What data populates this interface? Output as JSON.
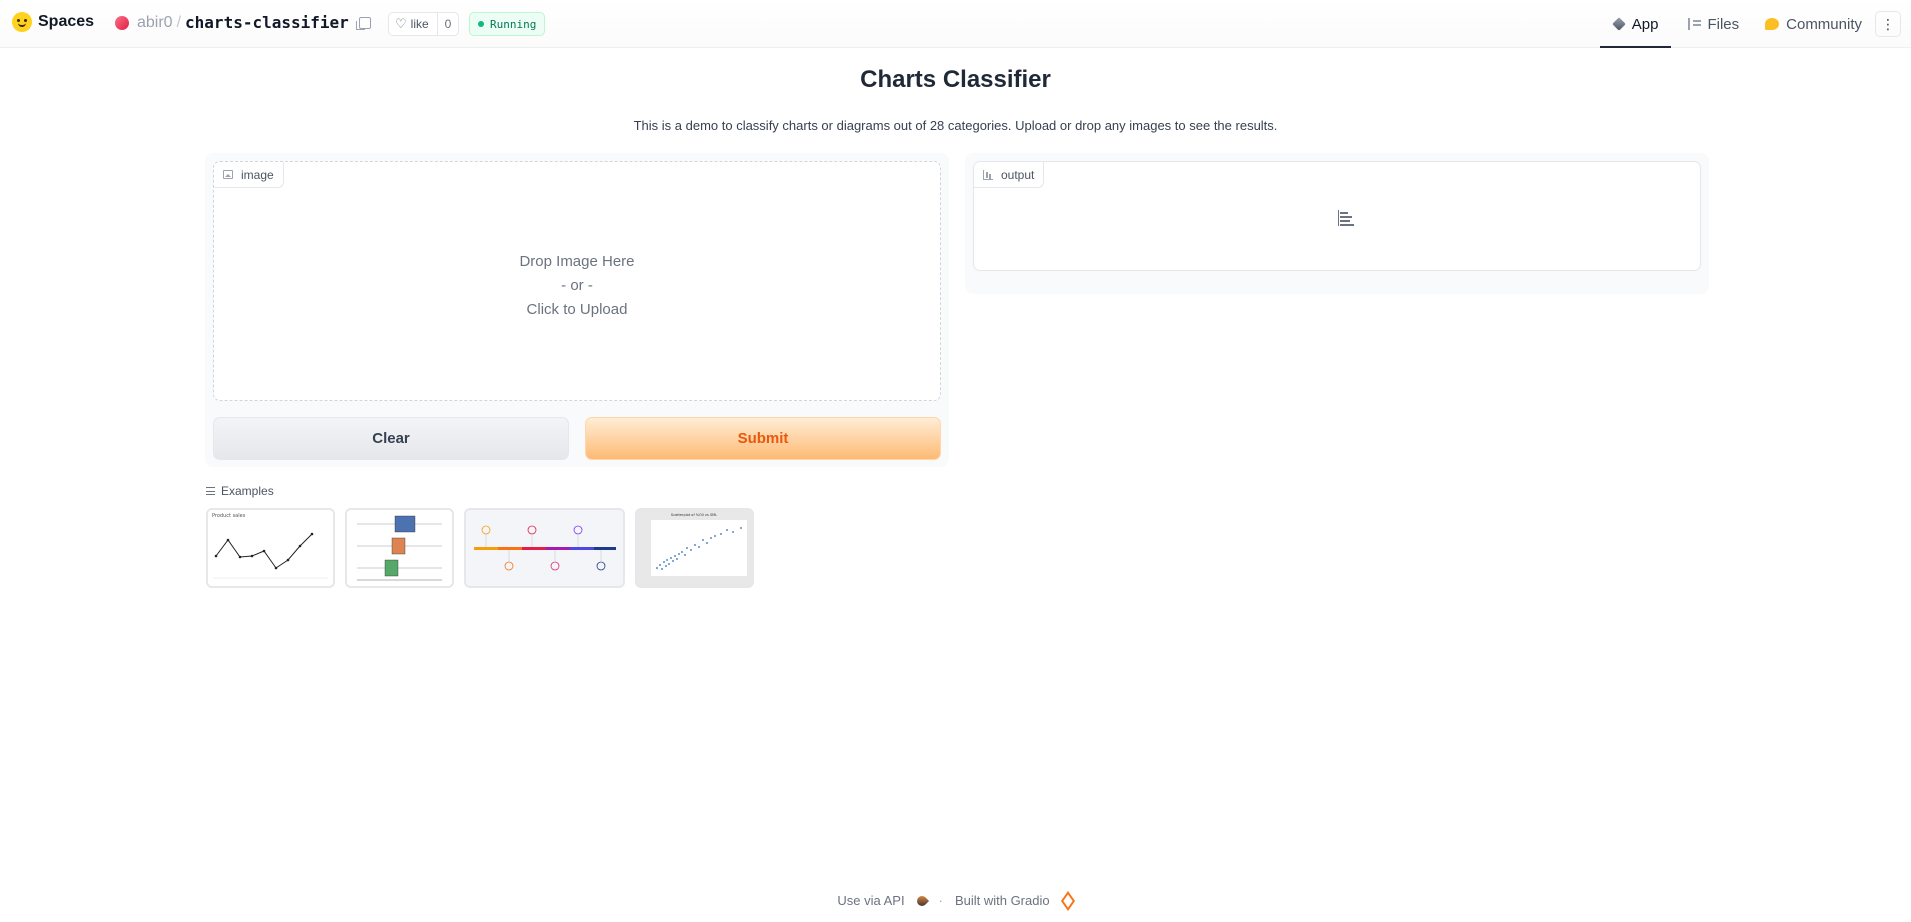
{
  "header": {
    "brand": "Spaces",
    "owner": "abir0",
    "separator": "/",
    "repo": "charts-classifier",
    "like_label": "like",
    "like_count": "0",
    "status": "Running",
    "tabs": [
      {
        "label": "App",
        "icon": "cube-icon",
        "active": true
      },
      {
        "label": "Files",
        "icon": "files-icon",
        "active": false
      },
      {
        "label": "Community",
        "icon": "community-icon",
        "active": false
      }
    ],
    "more": "⋮"
  },
  "main": {
    "title": "Charts Classifier",
    "description": "This is a demo to classify charts or diagrams out of 28 categories. Upload or drop any images to see the results."
  },
  "input": {
    "label": "image",
    "drop_line1": "Drop Image Here",
    "drop_line2": "- or -",
    "drop_line3": "Click to Upload",
    "clear_label": "Clear",
    "submit_label": "Submit"
  },
  "output": {
    "label": "output"
  },
  "examples": {
    "label": "Examples",
    "items": [
      {
        "kind": "line chart",
        "caption": "Product sales"
      },
      {
        "kind": "box plot"
      },
      {
        "kind": "timeline"
      },
      {
        "kind": "scatter plot",
        "caption": "Scatterplot of %Oil vs SML"
      }
    ]
  },
  "footer": {
    "api": "Use via API",
    "dot": "·",
    "built": "Built with Gradio"
  },
  "colors": {
    "accent": "#ea580c",
    "submit_bg": "#fdba74",
    "status_green": "#10b981"
  }
}
